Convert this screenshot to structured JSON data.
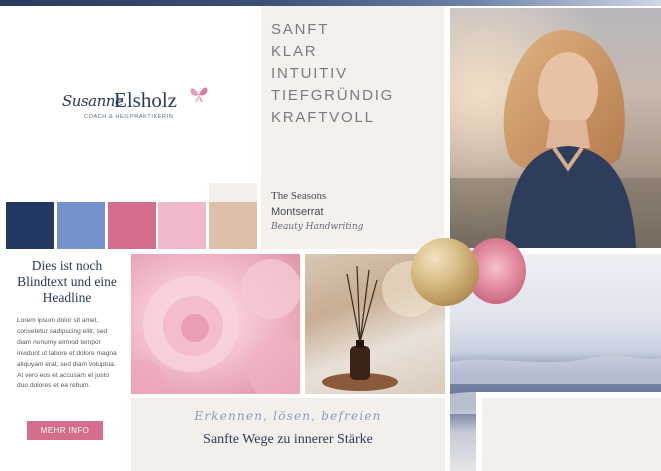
{
  "logo": {
    "script": "Susanne",
    "name": "Elsholz",
    "subtitle": "COACH & HEILPRAKTIKERIN",
    "icon": "butterfly-icon"
  },
  "palette": {
    "swatches": [
      {
        "name": "navy",
        "color": "#223761"
      },
      {
        "name": "cornflower",
        "color": "#7591cb"
      },
      {
        "name": "rose",
        "color": "#d46d8b"
      },
      {
        "name": "light-pink",
        "color": "#f0b9ca"
      },
      {
        "name": "sand",
        "color": "#ddbfaa"
      }
    ],
    "cream": "#f3eee9"
  },
  "keywords": [
    "SANFT",
    "KLAR",
    "INTUITIV",
    "TIEFGRÜNDIG",
    "KRAFTVOLL"
  ],
  "fonts": [
    "The Seasons",
    "Montserrat",
    "Beauty Handwriting"
  ],
  "content": {
    "headline": "Dies ist noch Blindtext und eine Headline",
    "body": "Lorem ipsum dolor sit amet, consetetur sadipscing elitr, sed diam nonumy eirmod tempor invidunt ut labore et dolore magna aliquyam erat, sed diam voluptua. At vero eos et accusam et justo duo dolores et ea rebum.",
    "button_label": "MEHR INFO"
  },
  "tagline": {
    "script": "Erkennen, lösen, befreien",
    "main": "Sanfte Wege zu innerer Stärke"
  }
}
